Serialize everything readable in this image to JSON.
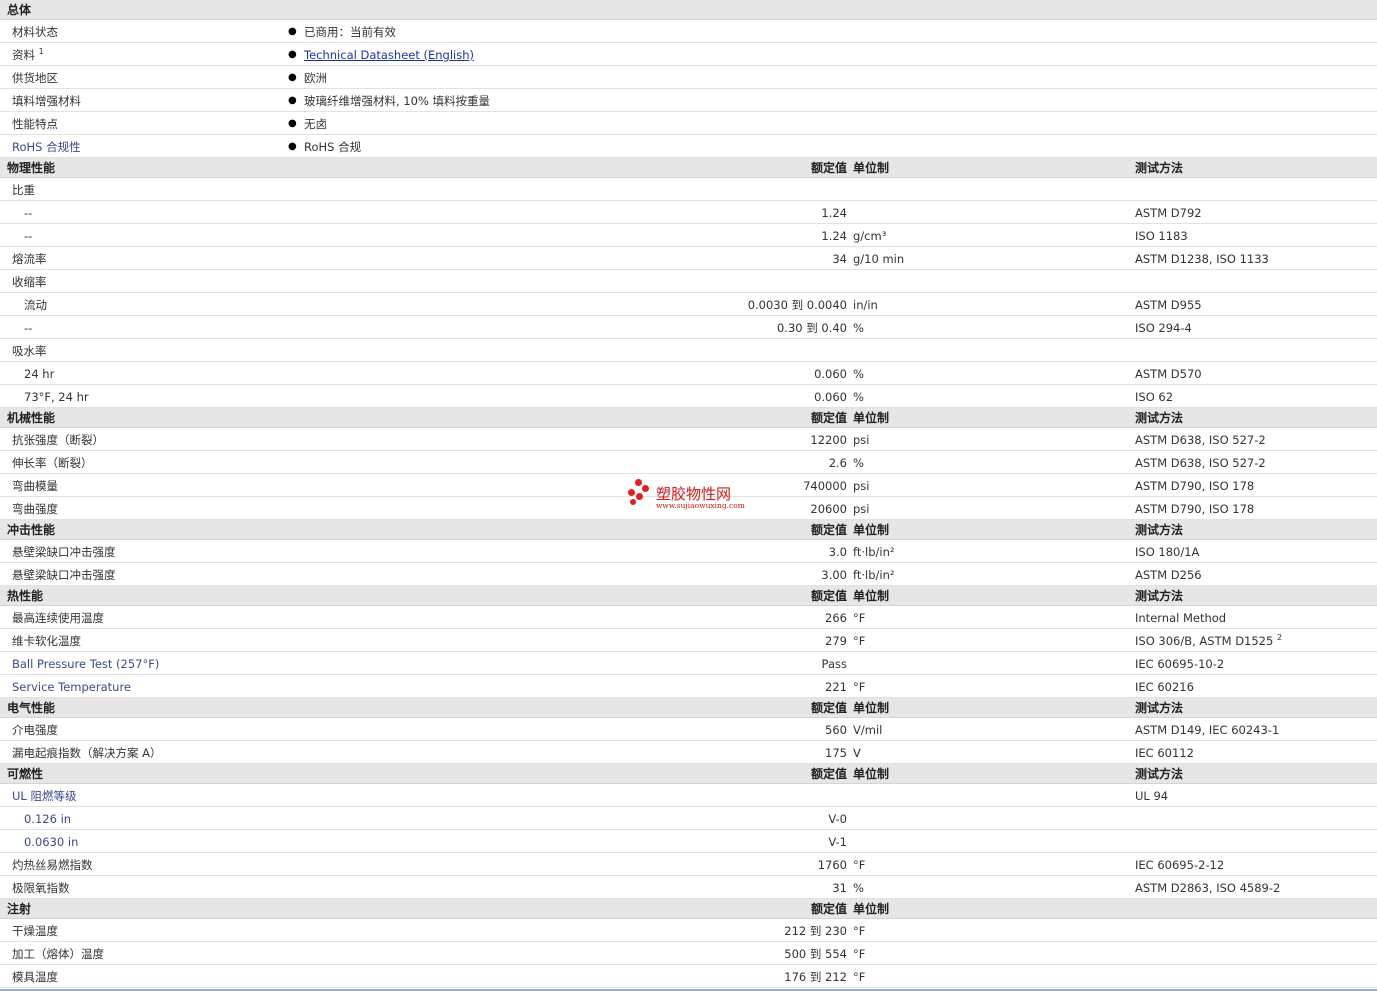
{
  "general": {
    "title": "总体",
    "rows": [
      {
        "label": "材料状态",
        "value": "已商用：当前有效"
      },
      {
        "label": "资料",
        "sup": "1",
        "value": "Technical Datasheet (English)",
        "link": true
      },
      {
        "label": "供货地区",
        "value": "欧洲"
      },
      {
        "label": "填料增强材料",
        "value": "玻璃纤维增强材料, 10% 填料按重量"
      },
      {
        "label": "性能特点",
        "value": "无卤"
      },
      {
        "label": "RoHS 合规性",
        "value": "RoHS 合规",
        "blue": true
      }
    ]
  },
  "columns": {
    "nominal": "额定值",
    "unit": "单位制",
    "test": "测试方法"
  },
  "sections": [
    {
      "title": "物理性能",
      "rows": [
        {
          "label": "比重"
        },
        {
          "label": "--",
          "sub": true,
          "value": "1.24",
          "test": "ASTM D792"
        },
        {
          "label": "--",
          "sub": true,
          "value": "1.24",
          "unit": "g/cm³",
          "test": "ISO 1183"
        },
        {
          "label": "熔流率",
          "value": "34",
          "unit": "g/10 min",
          "test": "ASTM D1238, ISO 1133"
        },
        {
          "label": "收缩率"
        },
        {
          "label": "流动",
          "sub": true,
          "value": "0.0030 到  0.0040",
          "unit": "in/in",
          "test": "ASTM D955"
        },
        {
          "label": "--",
          "sub": true,
          "value": "0.30 到  0.40",
          "unit": "%",
          "test": "ISO 294-4"
        },
        {
          "label": "吸水率"
        },
        {
          "label": "24 hr",
          "sub": true,
          "value": "0.060",
          "unit": "%",
          "test": "ASTM D570"
        },
        {
          "label": "73°F, 24 hr",
          "sub": true,
          "value": "0.060",
          "unit": "%",
          "test": "ISO 62"
        }
      ]
    },
    {
      "title": "机械性能",
      "rows": [
        {
          "label": "抗张强度（断裂）",
          "value": "12200",
          "unit": "psi",
          "test": "ASTM D638, ISO 527-2"
        },
        {
          "label": "伸长率（断裂）",
          "value": "2.6",
          "unit": "%",
          "test": "ASTM D638, ISO 527-2"
        },
        {
          "label": "弯曲模量",
          "value": "740000",
          "unit": "psi",
          "test": "ASTM D790, ISO 178"
        },
        {
          "label": "弯曲强度",
          "value": "20600",
          "unit": "psi",
          "test": "ASTM D790, ISO 178"
        }
      ]
    },
    {
      "title": "冲击性能",
      "rows": [
        {
          "label": "悬壁梁缺口冲击强度",
          "value": "3.0",
          "unit": "ft·lb/in²",
          "test": "ISO 180/1A"
        },
        {
          "label": "悬壁梁缺口冲击强度",
          "value": "3.00",
          "unit": "ft·lb/in²",
          "test": "ASTM D256"
        }
      ]
    },
    {
      "title": "热性能",
      "rows": [
        {
          "label": "最高连续使用温度",
          "value": "266",
          "unit": "°F",
          "test": "Internal Method"
        },
        {
          "label": "维卡软化温度",
          "value": "279",
          "unit": "°F",
          "test": "ISO 306/B, ASTM D1525",
          "test_sup": "2"
        },
        {
          "label": "Ball Pressure Test (257°F)",
          "blue": true,
          "value": "Pass",
          "test": "IEC 60695-10-2"
        },
        {
          "label": "Service Temperature",
          "blue": true,
          "value": "221",
          "unit": "°F",
          "test": "IEC 60216"
        }
      ]
    },
    {
      "title": "电气性能",
      "rows": [
        {
          "label": "介电强度",
          "value": "560",
          "unit": "V/mil",
          "test": "ASTM D149, IEC 60243-1"
        },
        {
          "label": "漏电起痕指数（解决方案  A）",
          "value": "175",
          "unit": "V",
          "test": "IEC 60112"
        }
      ]
    },
    {
      "title": "可燃性",
      "rows": [
        {
          "label": "UL 阻燃等级",
          "blue": true,
          "test": "UL 94"
        },
        {
          "label": "0.126 in",
          "sub": true,
          "blue": true,
          "value": "V-0"
        },
        {
          "label": "0.0630 in",
          "sub": true,
          "blue": true,
          "value": "V-1"
        },
        {
          "label": "灼热丝易燃指数",
          "value": "1760",
          "unit": "°F",
          "test": "IEC 60695-2-12"
        },
        {
          "label": "极限氧指数",
          "value": "31",
          "unit": "%",
          "test": "ASTM D2863, ISO 4589-2"
        }
      ]
    },
    {
      "title": "注射",
      "no_test_col": true,
      "rows": [
        {
          "label": "干燥温度",
          "value": "212 到  230",
          "unit": "°F"
        },
        {
          "label": "加工（熔体）温度",
          "value": "500 到  554",
          "unit": "°F"
        },
        {
          "label": "模具温度",
          "value": "176 到  212",
          "unit": "°F"
        }
      ]
    }
  ],
  "watermark": {
    "title": "塑胶物性网",
    "url": "www.sujiaowuxing.com",
    "color": "#e02020"
  }
}
